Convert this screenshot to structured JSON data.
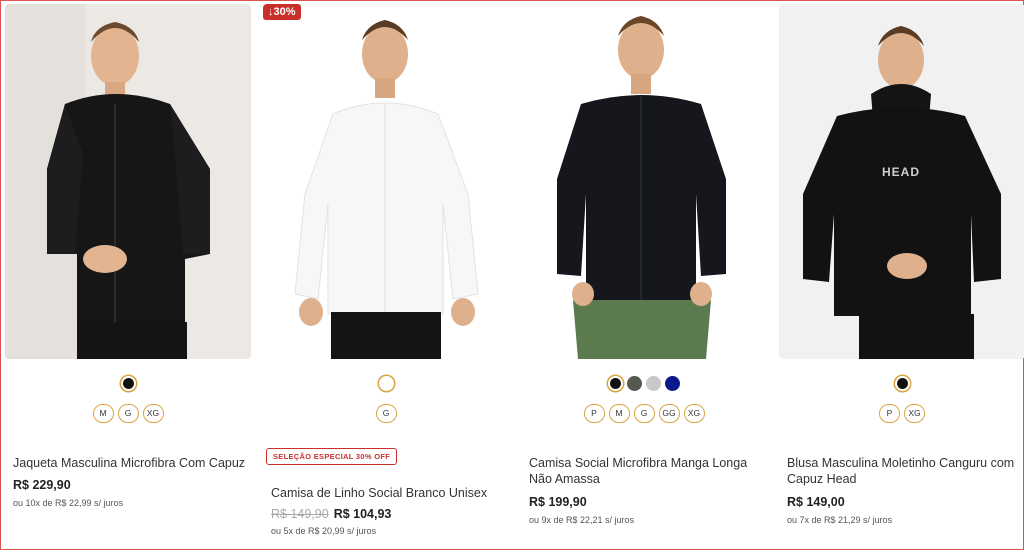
{
  "colors": {
    "accent_gold": "#d9a441",
    "sale_red": "#c9302c"
  },
  "products": [
    {
      "name": "Jaqueta Masculina Microfibra Com Capuz",
      "price": "R$ 229,90",
      "installments": "ou 10x de R$ 22,99 s/ juros",
      "swatches": [
        "#111111"
      ],
      "sizes": [
        "M",
        "G",
        "XG"
      ]
    },
    {
      "discount_badge": "↓30%",
      "special_badge": "SELEÇÃO ESPECIAL 30% OFF",
      "name": "Camisa de Linho Social Branco Unisex",
      "old_price": "R$ 149,90",
      "price": "R$ 104,93",
      "installments": "ou 5x de R$ 20,99 s/ juros",
      "swatches": [
        "#ffffff"
      ],
      "sizes": [
        "G"
      ]
    },
    {
      "name": "Camisa Social Microfibra Manga Longa Não Amassa",
      "price": "R$ 199,90",
      "installments": "ou 9x de R$ 22,21 s/ juros",
      "swatches": [
        "#111111",
        "#555950",
        "#c8c8c8",
        "#0a1a8c"
      ],
      "sizes": [
        "P",
        "M",
        "G",
        "GG",
        "XG"
      ]
    },
    {
      "name": "Blusa Masculina Moletinho Canguru com Capuz Head",
      "price": "R$ 149,00",
      "installments": "ou 7x de R$ 21,29 s/ juros",
      "swatches": [
        "#111111"
      ],
      "sizes": [
        "P",
        "XG"
      ]
    }
  ],
  "logo_text": "HEAD"
}
